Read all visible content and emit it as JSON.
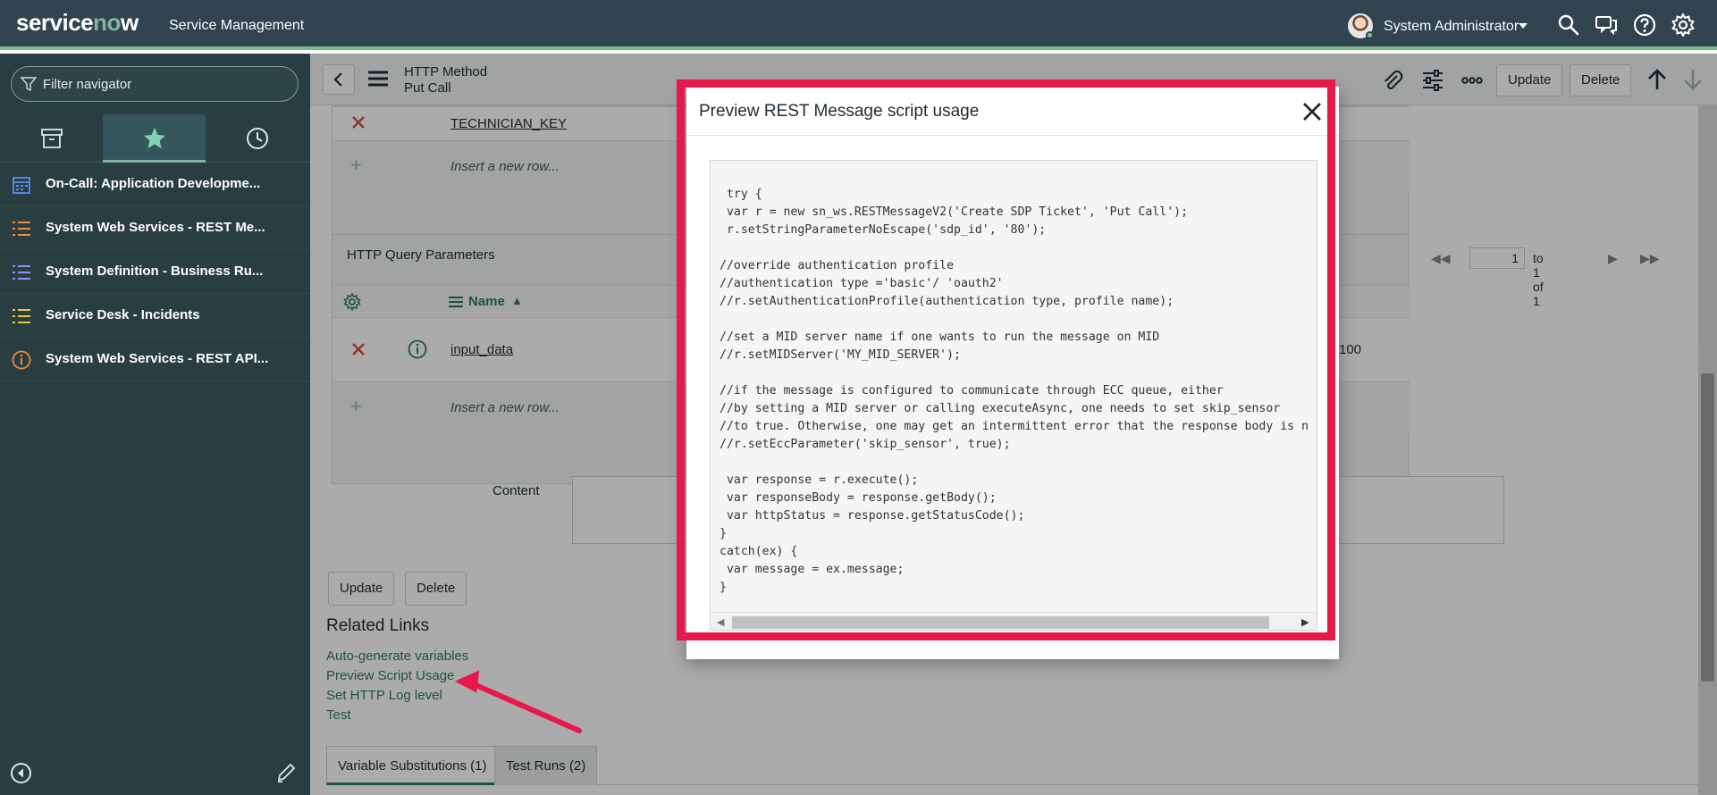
{
  "banner": {
    "logo_pre": "service",
    "logo_o": "n",
    "logo_post": "w",
    "product": "Service Management",
    "user_name": "System Administrator"
  },
  "navigator": {
    "filter_placeholder": "Filter navigator",
    "items": [
      {
        "label": "On-Call: Application Developme...",
        "icon": "calendar-icon",
        "color": "#5b8def"
      },
      {
        "label": "System Web Services - REST Me...",
        "icon": "list-icon",
        "color": "#f0883e"
      },
      {
        "label": "System Definition - Business Ru...",
        "icon": "list-icon",
        "color": "#9b8cf2"
      },
      {
        "label": "Service Desk - Incidents",
        "icon": "list-icon",
        "color": "#e8c84a"
      },
      {
        "label": "System Web Services - REST API...",
        "icon": "info-icon",
        "color": "#f0883e"
      }
    ]
  },
  "form": {
    "title": "HTTP Method",
    "subtitle": "Put Call",
    "update_label": "Update",
    "delete_label": "Delete",
    "top_list": {
      "row_value": "TECHNICIAN_KEY",
      "insert_text": "Insert a new row..."
    },
    "query_params": {
      "title": "HTTP Query Parameters",
      "page_number": "1",
      "page_of": "to 1 of 1",
      "column_name": "Name",
      "row_name": "input_data",
      "row_order": "100",
      "insert_text": "Insert a new row..."
    },
    "content_label": "Content",
    "related_title": "Related Links",
    "related_links": [
      "Auto-generate variables",
      "Preview Script Usage",
      "Set HTTP Log level",
      "Test"
    ],
    "tabs": [
      "Variable Substitutions (1)",
      "Test Runs (2)"
    ]
  },
  "modal": {
    "title": "Preview REST Message script usage",
    "code": " try {\n var r = new sn_ws.RESTMessageV2('Create SDP Ticket', 'Put Call');\n r.setStringParameterNoEscape('sdp_id', '80');\n\n//override authentication profile\n//authentication type ='basic'/ 'oauth2'\n//r.setAuthenticationProfile(authentication type, profile name);\n\n//set a MID server name if one wants to run the message on MID\n//r.setMIDServer('MY_MID_SERVER');\n\n//if the message is configured to communicate through ECC queue, either\n//by setting a MID server or calling executeAsync, one needs to set skip_sensor\n//to true. Otherwise, one may get an intermittent error that the response body is n\n//r.setEccParameter('skip_sensor', true);\n\n var response = r.execute();\n var responseBody = response.getBody();\n var httpStatus = response.getStatusCode();\n}\ncatch(ex) {\n var message = ex.message;\n}"
  },
  "colors": {
    "banner": "#30434f",
    "navigator": "#293e40",
    "highlight": "#e8184d",
    "link": "#2e7d5b"
  }
}
